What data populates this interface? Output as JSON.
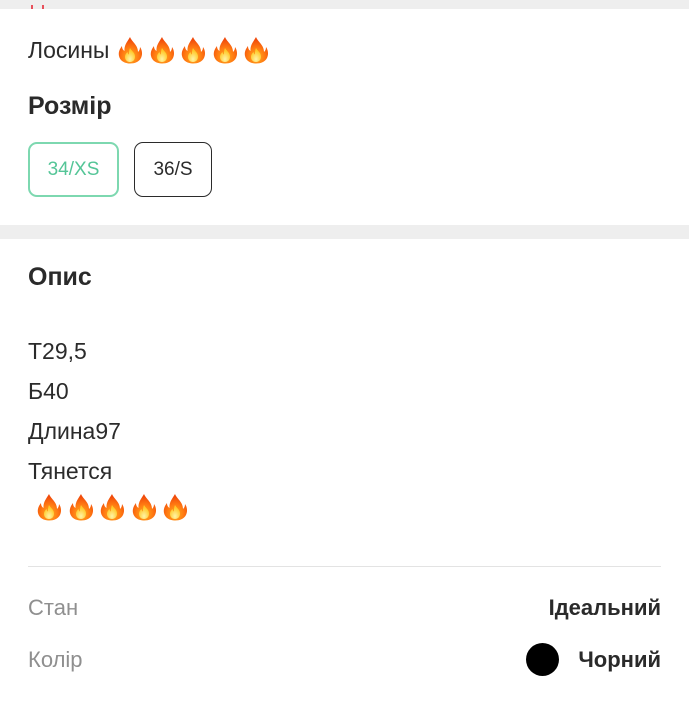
{
  "listing": {
    "title": "Лосины",
    "title_emoji": [
      "fire-icon",
      "fire-icon",
      "fire-icon",
      "fire-icon",
      "fire-icon"
    ]
  },
  "size_section": {
    "heading": "Розмір",
    "options": [
      {
        "label": "34/XS",
        "selected": true
      },
      {
        "label": "36/S",
        "selected": false
      }
    ]
  },
  "description": {
    "heading": "Опис",
    "lines": [
      "Т29,5",
      "Б40",
      "Длина97",
      "Тянется"
    ],
    "emoji": [
      "fire-icon",
      "fire-icon",
      "fire-icon",
      "fire-icon",
      "fire-icon"
    ]
  },
  "attributes": {
    "condition": {
      "label": "Стан",
      "value": "Ідеальний"
    },
    "color": {
      "label": "Колір",
      "value": "Чорний",
      "swatch": "#000000"
    }
  },
  "colors": {
    "accent": "#54c597",
    "accent_border": "#7dd8b0",
    "text": "#2b2b2b",
    "muted": "#8f8f8f",
    "background": "#eeeeee"
  }
}
